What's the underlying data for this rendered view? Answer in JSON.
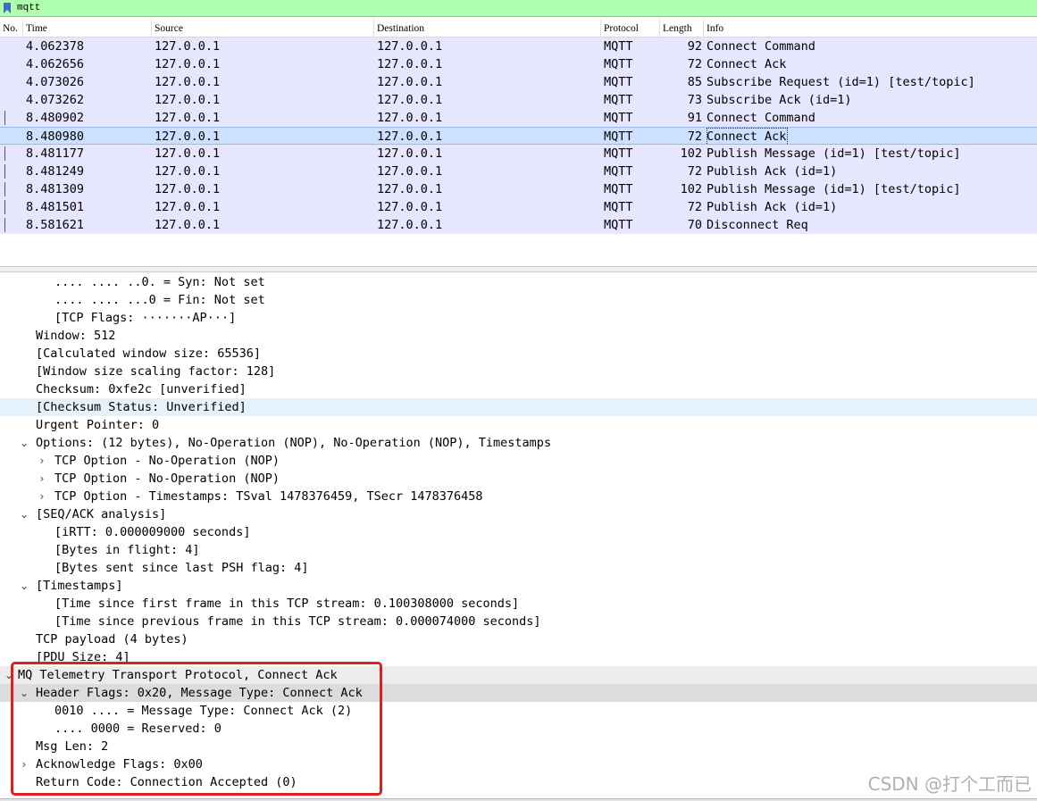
{
  "filter": {
    "value": "mqtt"
  },
  "columns": [
    "No.",
    "Time",
    "Source",
    "Destination",
    "Protocol",
    "Length",
    "Info"
  ],
  "packets": [
    {
      "time": "4.062378",
      "src": "127.0.0.1",
      "dst": "127.0.0.1",
      "proto": "MQTT",
      "len": "92",
      "info": "Connect Command"
    },
    {
      "time": "4.062656",
      "src": "127.0.0.1",
      "dst": "127.0.0.1",
      "proto": "MQTT",
      "len": "72",
      "info": "Connect Ack"
    },
    {
      "time": "4.073026",
      "src": "127.0.0.1",
      "dst": "127.0.0.1",
      "proto": "MQTT",
      "len": "85",
      "info": "Subscribe Request (id=1) [test/topic]"
    },
    {
      "time": "4.073262",
      "src": "127.0.0.1",
      "dst": "127.0.0.1",
      "proto": "MQTT",
      "len": "73",
      "info": "Subscribe Ack (id=1)"
    },
    {
      "time": "8.480902",
      "src": "127.0.0.1",
      "dst": "127.0.0.1",
      "proto": "MQTT",
      "len": "91",
      "info": "Connect Command"
    },
    {
      "time": "8.480980",
      "src": "127.0.0.1",
      "dst": "127.0.0.1",
      "proto": "MQTT",
      "len": "72",
      "info": "Connect Ack"
    },
    {
      "time": "8.481177",
      "src": "127.0.0.1",
      "dst": "127.0.0.1",
      "proto": "MQTT",
      "len": "102",
      "info": "Publish Message (id=1) [test/topic]"
    },
    {
      "time": "8.481249",
      "src": "127.0.0.1",
      "dst": "127.0.0.1",
      "proto": "MQTT",
      "len": "72",
      "info": "Publish Ack (id=1)"
    },
    {
      "time": "8.481309",
      "src": "127.0.0.1",
      "dst": "127.0.0.1",
      "proto": "MQTT",
      "len": "102",
      "info": "Publish Message (id=1) [test/topic]"
    },
    {
      "time": "8.481501",
      "src": "127.0.0.1",
      "dst": "127.0.0.1",
      "proto": "MQTT",
      "len": "72",
      "info": "Publish Ack (id=1)"
    },
    {
      "time": "8.581621",
      "src": "127.0.0.1",
      "dst": "127.0.0.1",
      "proto": "MQTT",
      "len": "70",
      "info": "Disconnect Req"
    }
  ],
  "details": [
    ".... .... ..0. = Syn: Not set",
    ".... .... ...0 = Fin: Not set",
    "[TCP Flags: ·······AP···]",
    "Window: 512",
    "[Calculated window size: 65536]",
    "[Window size scaling factor: 128]",
    "Checksum: 0xfe2c [unverified]",
    "[Checksum Status: Unverified]",
    "Urgent Pointer: 0",
    "Options: (12 bytes), No-Operation (NOP), No-Operation (NOP), Timestamps",
    "TCP Option - No-Operation (NOP)",
    "TCP Option - No-Operation (NOP)",
    "TCP Option - Timestamps: TSval 1478376459, TSecr 1478376458",
    "[SEQ/ACK analysis]",
    "[iRTT: 0.000009000 seconds]",
    "[Bytes in flight: 4]",
    "[Bytes sent since last PSH flag: 4]",
    "[Timestamps]",
    "[Time since first frame in this TCP stream: 0.100308000 seconds]",
    "[Time since previous frame in this TCP stream: 0.000074000 seconds]",
    "TCP payload (4 bytes)",
    "[PDU Size: 4]",
    "MQ Telemetry Transport Protocol, Connect Ack",
    "Header Flags: 0x20, Message Type: Connect Ack",
    "0010 .... = Message Type: Connect Ack (2)",
    ".... 0000 = Reserved: 0",
    "Msg Len: 2",
    "Acknowledge Flags: 0x00",
    "Return Code: Connection Accepted (0)"
  ],
  "icons": {
    "collapsed": "chevron-right-icon",
    "expanded": "chevron-down-icon"
  },
  "colors": {
    "filter_bg": "#afffaf",
    "row_bg": "#e7e6ff",
    "selected_bg": "#cce0ff",
    "annotation": "#e02020"
  },
  "watermark": "CSDN @打个工而已"
}
